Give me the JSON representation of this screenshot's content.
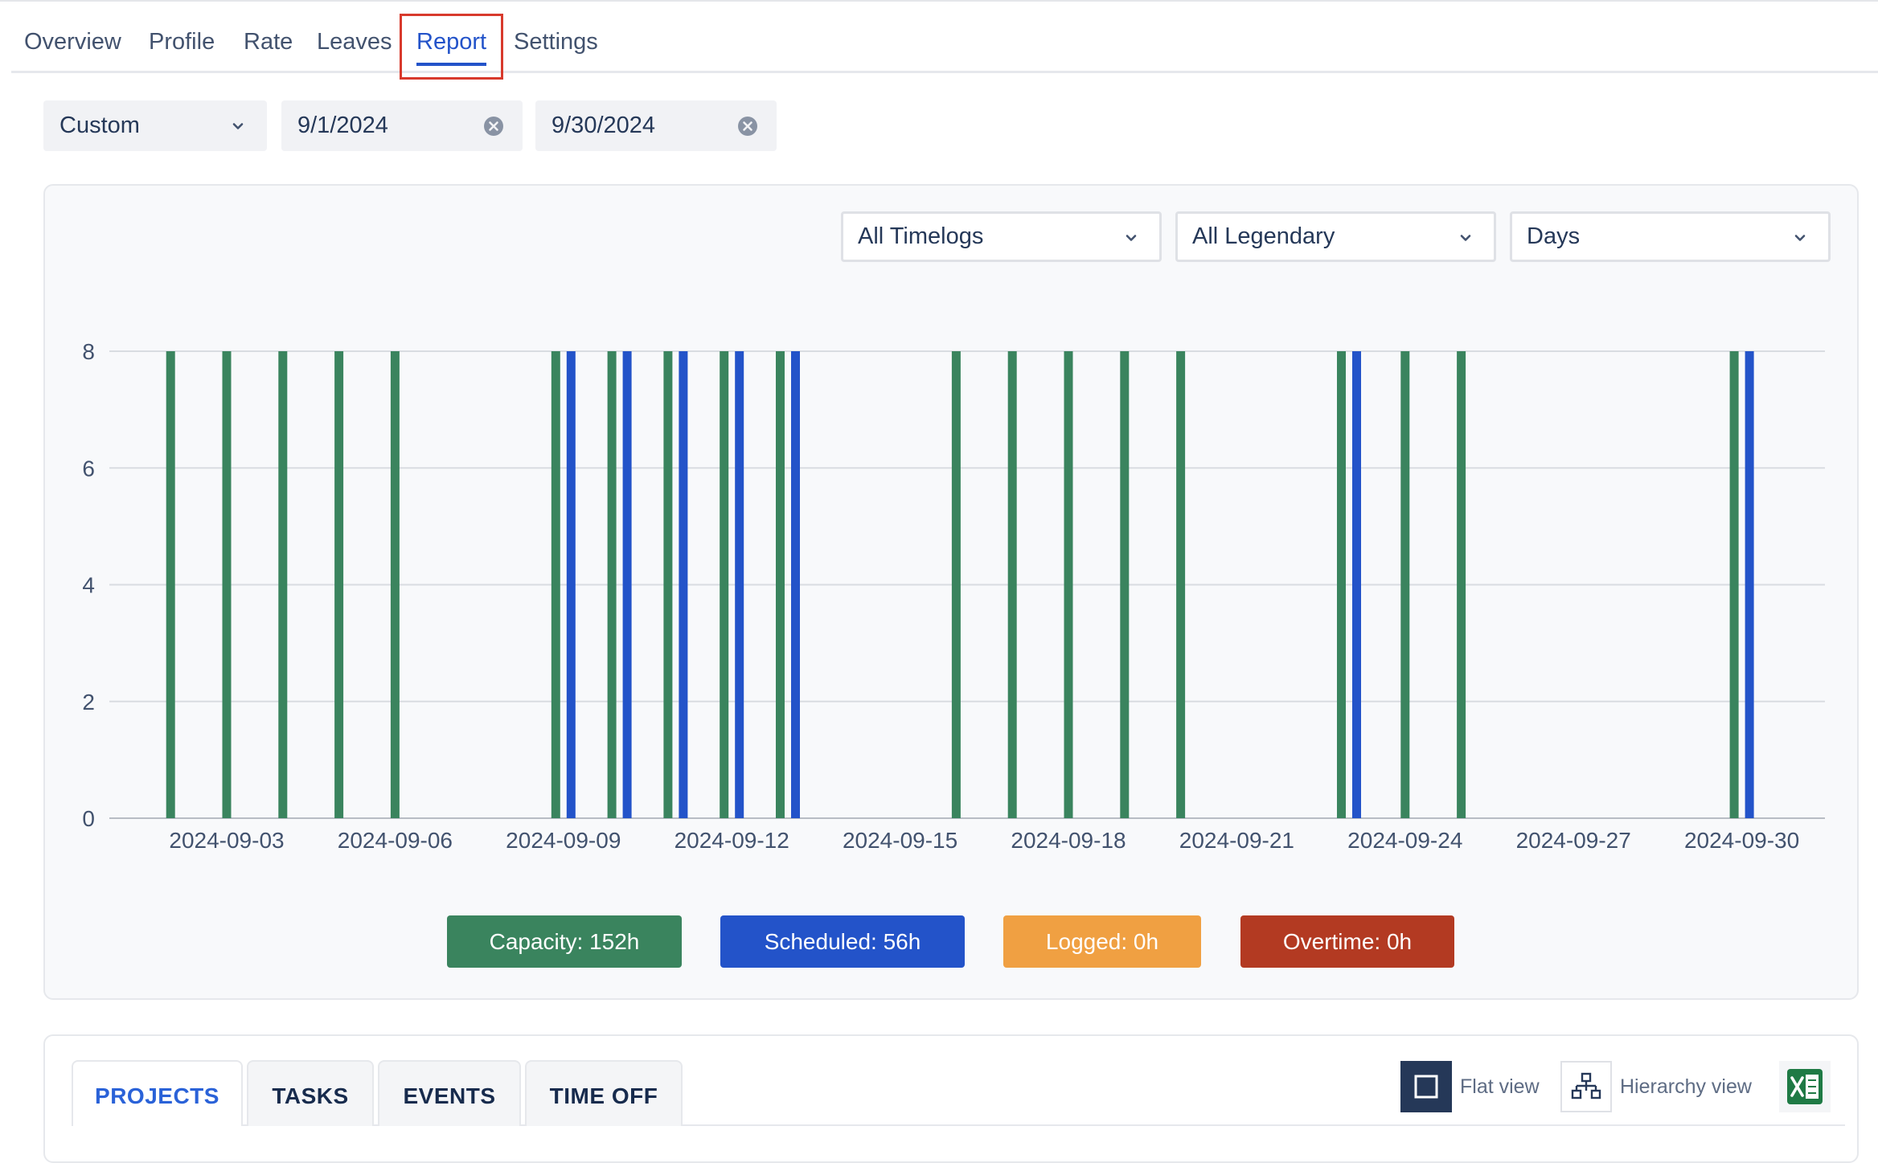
{
  "nav": {
    "tabs": [
      {
        "label": "Overview",
        "active": false
      },
      {
        "label": "Profile",
        "active": false
      },
      {
        "label": "Rate",
        "active": false
      },
      {
        "label": "Leaves",
        "active": false
      },
      {
        "label": "Report",
        "active": true
      },
      {
        "label": "Settings",
        "active": false
      }
    ]
  },
  "filters": {
    "range": "Custom",
    "start_date": "9/1/2024",
    "end_date": "9/30/2024"
  },
  "chart_controls": {
    "timelogs": "All Timelogs",
    "legendary": "All Legendary",
    "period": "Days"
  },
  "colors": {
    "capacity": "#3a845e",
    "scheduled": "#2353c9",
    "logged": "#f0a042",
    "overtime": "#b33a22",
    "accent": "#2353c9",
    "highlight_frame": "#d83a2c"
  },
  "chart_data": {
    "type": "bar",
    "x_type": "date",
    "x_range": [
      "2024-09-01",
      "2024-09-30"
    ],
    "x_ticks": [
      "2024-09-03",
      "2024-09-06",
      "2024-09-09",
      "2024-09-12",
      "2024-09-15",
      "2024-09-18",
      "2024-09-21",
      "2024-09-24",
      "2024-09-27",
      "2024-09-30"
    ],
    "ylim": [
      0,
      8
    ],
    "y_ticks": [
      0,
      2,
      4,
      6,
      8
    ],
    "grid": true,
    "series": [
      {
        "key": "capacity",
        "color": "#3a845e",
        "points": [
          {
            "date": "2024-09-02",
            "value": 8
          },
          {
            "date": "2024-09-03",
            "value": 8
          },
          {
            "date": "2024-09-04",
            "value": 8
          },
          {
            "date": "2024-09-05",
            "value": 8
          },
          {
            "date": "2024-09-06",
            "value": 8
          },
          {
            "date": "2024-09-09",
            "value": 8
          },
          {
            "date": "2024-09-10",
            "value": 8
          },
          {
            "date": "2024-09-11",
            "value": 8
          },
          {
            "date": "2024-09-12",
            "value": 8
          },
          {
            "date": "2024-09-13",
            "value": 8
          },
          {
            "date": "2024-09-16",
            "value": 8
          },
          {
            "date": "2024-09-17",
            "value": 8
          },
          {
            "date": "2024-09-18",
            "value": 8
          },
          {
            "date": "2024-09-19",
            "value": 8
          },
          {
            "date": "2024-09-20",
            "value": 8
          },
          {
            "date": "2024-09-23",
            "value": 8
          },
          {
            "date": "2024-09-24",
            "value": 8
          },
          {
            "date": "2024-09-25",
            "value": 8
          },
          {
            "date": "2024-09-30",
            "value": 8
          }
        ]
      },
      {
        "key": "scheduled",
        "color": "#2353c9",
        "points": [
          {
            "date": "2024-09-09",
            "value": 8
          },
          {
            "date": "2024-09-10",
            "value": 8
          },
          {
            "date": "2024-09-11",
            "value": 8
          },
          {
            "date": "2024-09-12",
            "value": 8
          },
          {
            "date": "2024-09-13",
            "value": 8
          },
          {
            "date": "2024-09-23",
            "value": 8
          },
          {
            "date": "2024-09-30",
            "value": 8
          }
        ]
      }
    ]
  },
  "summary": [
    {
      "key": "capacity",
      "label": "Capacity:",
      "value": "152h",
      "color": "#3a845e"
    },
    {
      "key": "scheduled",
      "label": "Scheduled:",
      "value": "56h",
      "color": "#2353c9"
    },
    {
      "key": "logged",
      "label": "Logged:",
      "value": "0h",
      "color": "#f0a042"
    },
    {
      "key": "overtime",
      "label": "Overtime:",
      "value": "0h",
      "color": "#b33a22"
    }
  ],
  "bottom_tabs": [
    {
      "label": "PROJECTS",
      "active": true
    },
    {
      "label": "TASKS",
      "active": false
    },
    {
      "label": "EVENTS",
      "active": false
    },
    {
      "label": "TIME OFF",
      "active": false
    }
  ],
  "views": {
    "flat_label": "Flat view",
    "hierarchy_label": "Hierarchy view"
  },
  "icons": [
    "chevron-down-icon",
    "clear-icon",
    "flat-view-icon",
    "hierarchy-icon",
    "excel-icon"
  ]
}
